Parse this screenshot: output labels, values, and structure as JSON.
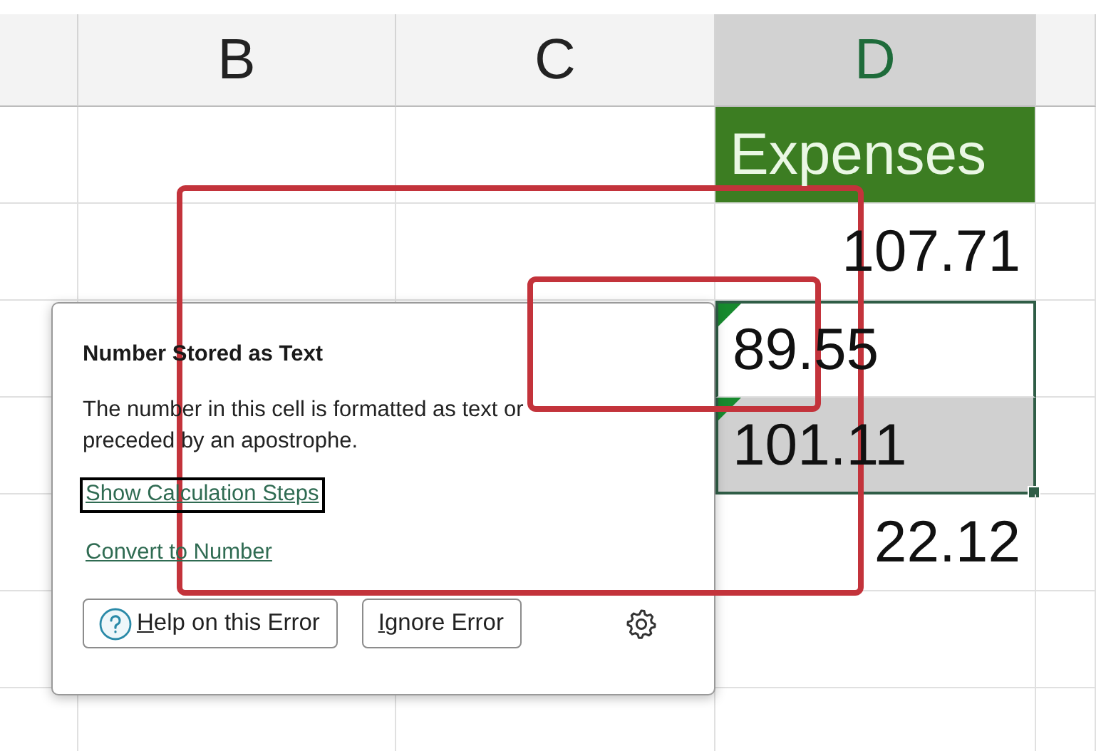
{
  "columns": [
    {
      "label": "B",
      "selected": false
    },
    {
      "label": "C",
      "selected": false
    },
    {
      "label": "D",
      "selected": true
    }
  ],
  "column_d_cells": [
    {
      "value": "Expenses",
      "kind": "header",
      "flagged": false,
      "selected": false
    },
    {
      "value": "107.71",
      "kind": "number",
      "flagged": false,
      "selected": false
    },
    {
      "value": "89.55",
      "kind": "text",
      "flagged": true,
      "selected": true
    },
    {
      "value": "101.11",
      "kind": "text",
      "flagged": true,
      "selected": true
    },
    {
      "value": "22.12",
      "kind": "number",
      "flagged": false,
      "selected": false
    }
  ],
  "error_popup": {
    "title": "Number Stored as Text",
    "message": "The number in this cell is formatted as text or preceded by an apostrophe.",
    "links": [
      {
        "label": "Show Calculation Steps",
        "focused": true
      },
      {
        "label": "Convert to Number",
        "focused": false
      }
    ],
    "buttons": [
      {
        "key": "H",
        "rest": "elp on this Error",
        "kind": "with_icon"
      },
      {
        "key": "I",
        "rest": "gnore Error",
        "kind": "plain"
      }
    ]
  }
}
